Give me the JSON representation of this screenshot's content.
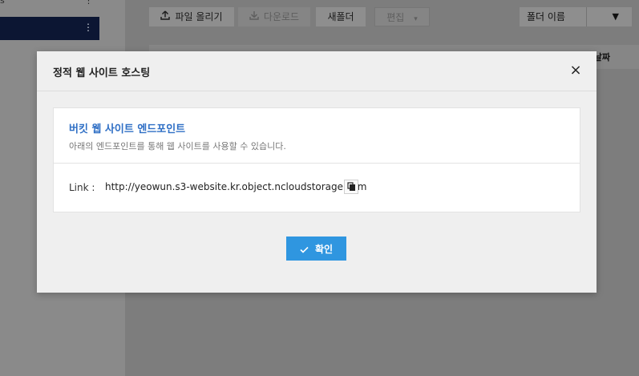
{
  "sidebar": {
    "top_item_text": "s",
    "menu_dots": "⋮"
  },
  "toolbar": {
    "upload_label": "파일 올리기",
    "download_label": "다운로드",
    "new_folder_label": "새폴더",
    "edit_label": "편집",
    "edit_caret": "▾",
    "sort_select_value": "폴더 이름",
    "sort_caret": "▼"
  },
  "table": {
    "date_column_partial": "날짜"
  },
  "modal": {
    "title": "정적 웹 사이트 호스팅",
    "close_icon": "×",
    "card": {
      "title": "버킷 웹 사이트 엔드포인트",
      "description": "아래의 엔드포인트를 통해 웹 사이트를 사용할 수 있습니다.",
      "link_label": "Link :",
      "link_value": "http://yeowun.s3-website.kr.object.ncloudstorage.com"
    },
    "confirm_label": "확인"
  },
  "colors": {
    "primary_button": "#2f96e0",
    "card_title": "#2f6fc5",
    "sidebar_selected": "#0c1633"
  }
}
